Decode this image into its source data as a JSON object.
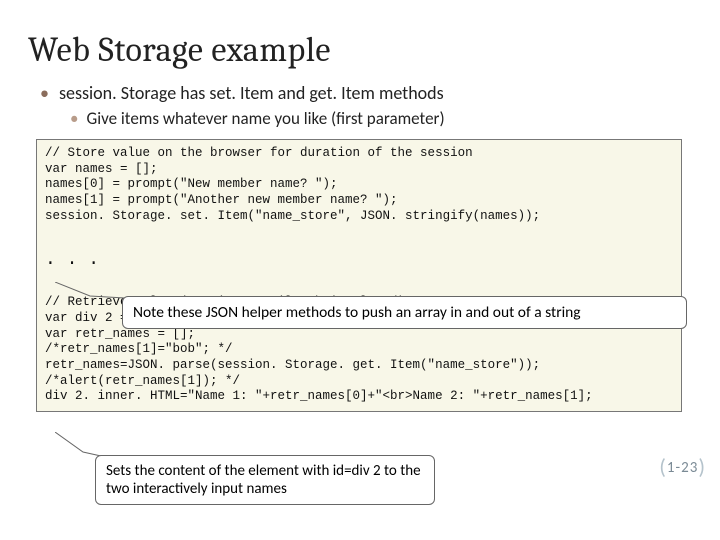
{
  "title": "Web Storage example",
  "bullets": {
    "l1": "session. Storage has set. Item and get. Item methods",
    "l2": "Give items whatever name you like (first parameter)"
  },
  "code": {
    "line1": "// Store value on the browser for duration of the session",
    "line2": "var names = [];",
    "line3": "names[0] = prompt(\"New member name? \");",
    "line4": "names[1] = prompt(\"Another new member name? \");",
    "line5": "session. Storage. set. Item(\"name_store\", JSON. stringify(names));",
    "ell": ". . .",
    "line6": "// Retrieve value (persists until tab is closed)",
    "line7": "var div 2 = document. get. Element. By. Id(\"div 2\");",
    "line8": "var retr_names = [];",
    "line9": "/*retr_names[1]=\"bob\"; */",
    "line10": "retr_names=JSON. parse(session. Storage. get. Item(\"name_store\"));",
    "line11": "/*alert(retr_names[1]); */",
    "line12": "div 2. inner. HTML=\"Name 1: \"+retr_names[0]+\"<br>Name 2: \"+retr_names[1];"
  },
  "callouts": {
    "c1": "Note these JSON helper methods to push an array in and out of a string",
    "c2": "Sets the content of the element with id=div 2 to the two interactively input names"
  },
  "page": "1-23"
}
